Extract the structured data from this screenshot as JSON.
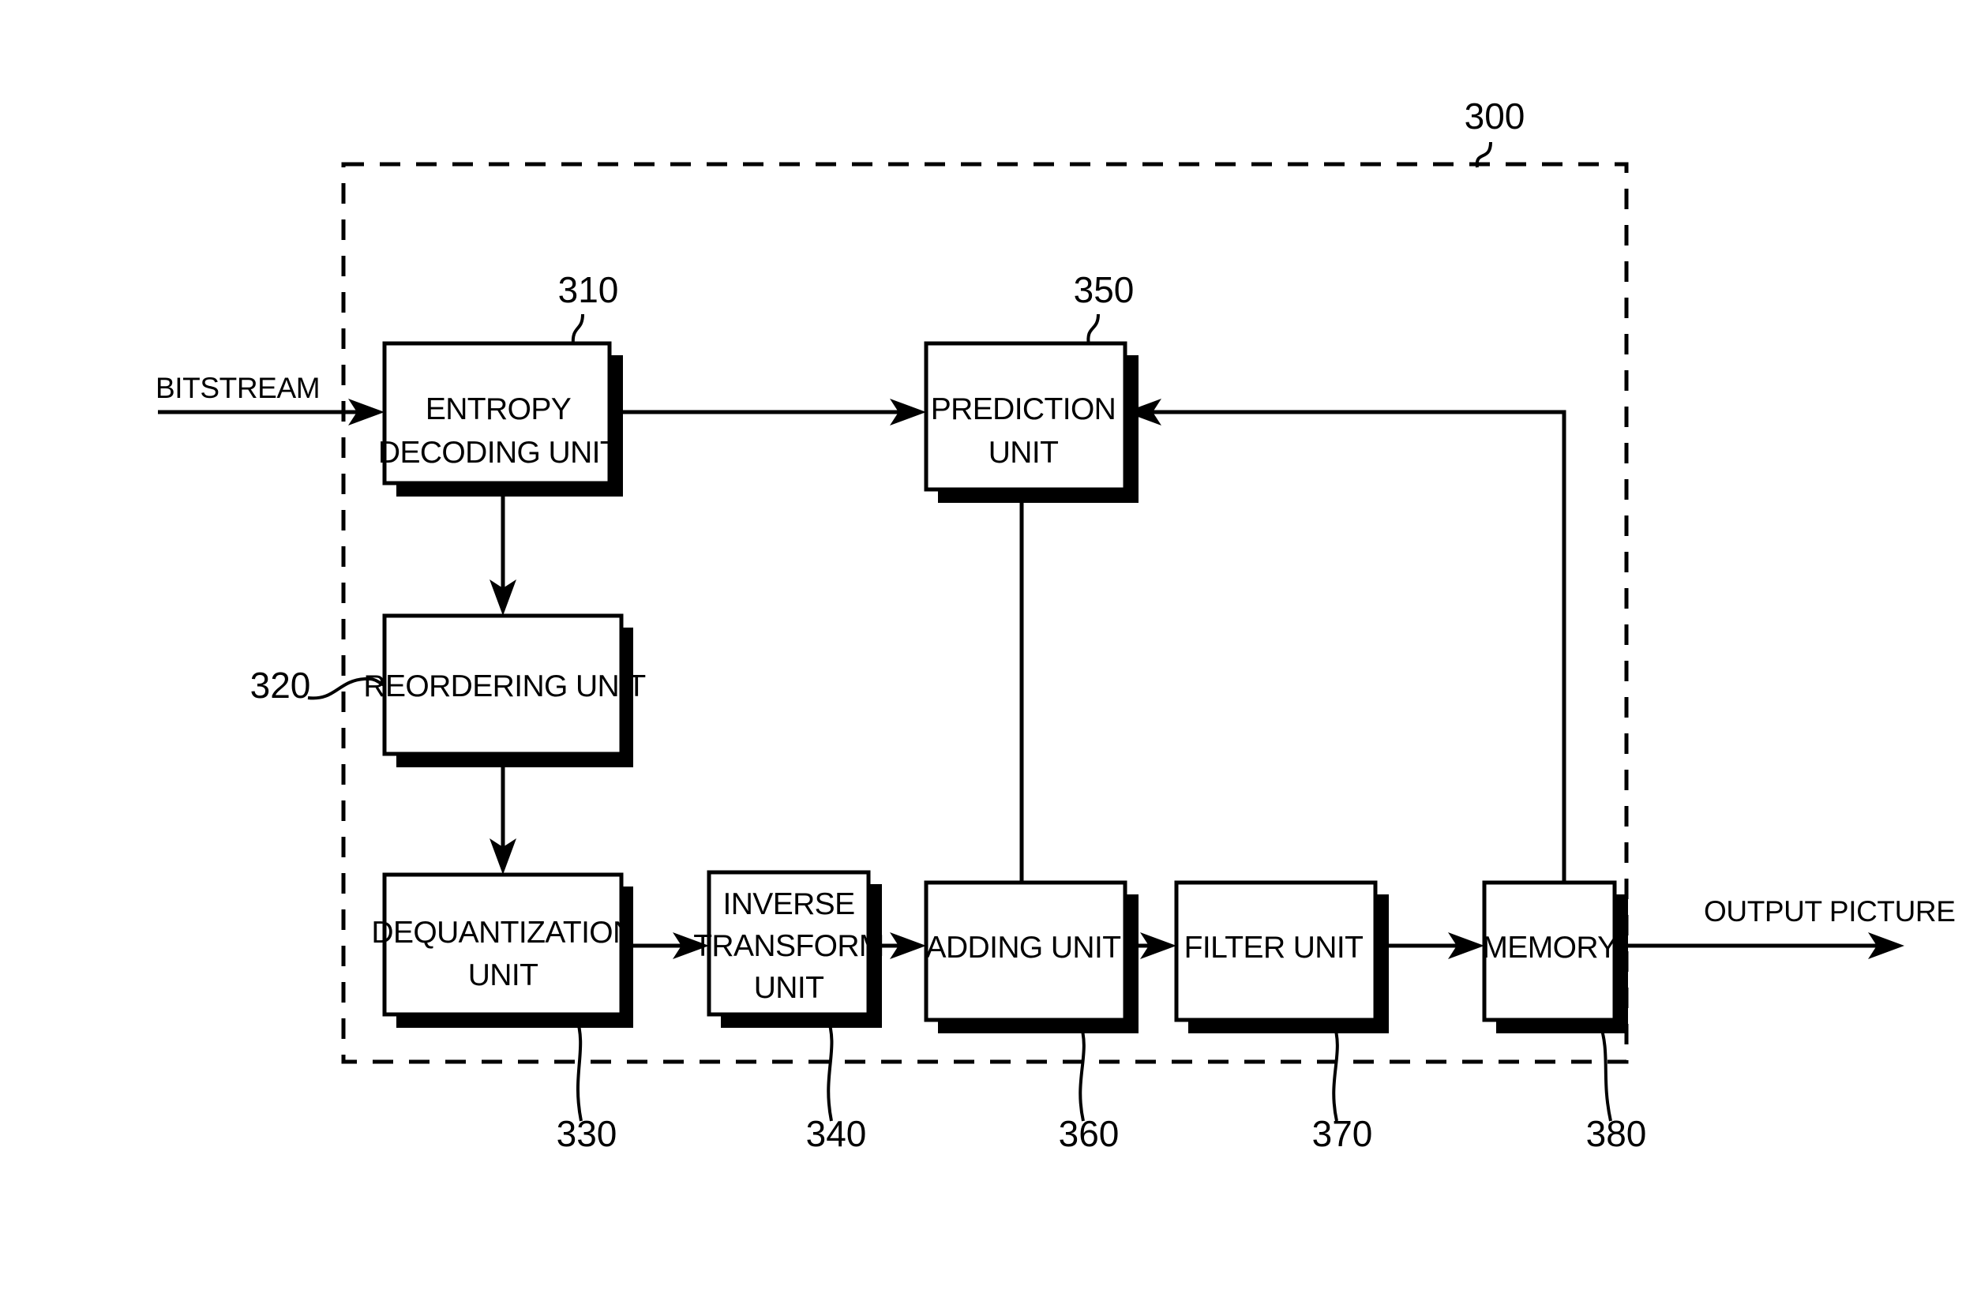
{
  "figure": {
    "outer_ref": "300",
    "external_labels": {
      "input": "BITSTREAM",
      "output": "OUTPUT PICTURE"
    },
    "blocks": [
      {
        "id": "entropy",
        "lines": [
          "ENTROPY",
          "DECODING UNIT"
        ],
        "ref": "310"
      },
      {
        "id": "reorder",
        "lines": [
          "REORDERING UNIT"
        ],
        "ref": "320"
      },
      {
        "id": "dequant",
        "lines": [
          "DEQUANTIZATION",
          "UNIT"
        ],
        "ref": "330"
      },
      {
        "id": "itransform",
        "lines": [
          "INVERSE",
          "TRANSFORM",
          "UNIT"
        ],
        "ref": "340"
      },
      {
        "id": "prediction",
        "lines": [
          "PREDICTION",
          "UNIT"
        ],
        "ref": "350"
      },
      {
        "id": "adding",
        "lines": [
          "ADDING UNIT"
        ],
        "ref": "360"
      },
      {
        "id": "filter",
        "lines": [
          "FILTER UNIT"
        ],
        "ref": "370"
      },
      {
        "id": "memory",
        "lines": [
          "MEMORY"
        ],
        "ref": "380"
      }
    ],
    "colors": {
      "ink": "#000000",
      "paper": "#ffffff"
    }
  }
}
